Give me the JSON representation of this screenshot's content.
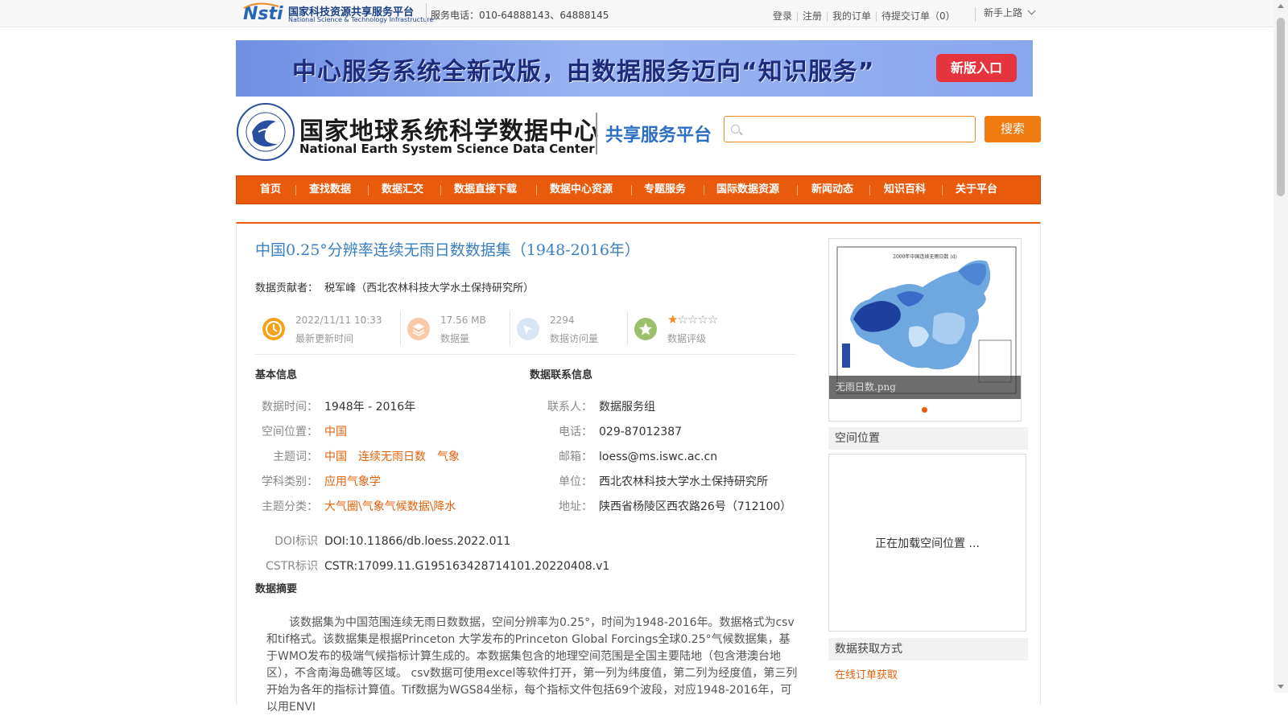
{
  "topbar": {
    "nsti_cn": "国家科技资源共享服务平台",
    "nsti_en": "National Science & Technology Infrastructure",
    "hotline": "服务电话：010-64888143、64888145",
    "links": [
      "登录",
      "注册",
      "我的订单",
      "待提交订单（0）"
    ],
    "newbie": "新手上路"
  },
  "banner": {
    "text": "中心服务系统全新改版，由数据服务迈向“知识服务”",
    "button": "新版入口"
  },
  "header": {
    "title_cn": "国家地球系统科学数据中心",
    "title_en": "National Earth System Science Data Center",
    "platform": "共享服务平台",
    "search_placeholder": "",
    "search_button": "搜索"
  },
  "nav": [
    "首页",
    "查找数据",
    "数据汇交",
    "数据直接下载",
    "数据中心资源",
    "专题服务",
    "国际数据资源",
    "新闻动态",
    "知识百科",
    "关于平台"
  ],
  "dataset": {
    "title": "中国0.25°分辨率连续无雨日数数据集（1948-2016年）",
    "contributor_label": "数据贡献者：",
    "contributor": "税军峰（西北农林科技大学水土保持研究所）",
    "stats": {
      "updated_value": "2022/11/11 10:33",
      "updated_label": "最新更新时间",
      "size_value": "17.56 MB",
      "size_label": "数据量",
      "visits_value": "2294",
      "visits_label": "数据访问量",
      "rating_label": "数据评级",
      "rating": 1,
      "rating_max": 5
    },
    "basic_info": {
      "heading": "基本信息",
      "time_label": "数据时间：",
      "time": "1948年 - 2016年",
      "location_label": "空间位置：",
      "location": "中国",
      "keywords_label": "主题词：",
      "keywords": [
        "中国",
        "连续无雨日数",
        "气象"
      ],
      "discipline_label": "学科类别：",
      "discipline": "应用气象学",
      "category_label": "主题分类：",
      "category": "大气圈\\气象气候数据\\降水",
      "doi_label": "DOI标识",
      "doi": "DOI:10.11866/db.loess.2022.011",
      "cstr_label": "CSTR标识",
      "cstr": "CSTR:17099.11.G195163428714101.20220408.v1"
    },
    "contact": {
      "heading": "数据联系信息",
      "person_label": "联系人：",
      "person": "数据服务组",
      "phone_label": "电话：",
      "phone": "029-87012387",
      "email_label": "邮箱：",
      "email": "loess@ms.iswc.ac.cn",
      "org_label": "单位：",
      "org": "西北农林科技大学水土保持研究所",
      "address_label": "地址：",
      "address": "陕西省杨陵区西农路26号（712100）"
    },
    "abstract_heading": "数据摘要",
    "abstract": "该数据集为中国范围连续无雨日数数据，空间分辨率为0.25°，时间为1948-2016年。数据格式为csv和tif格式。该数据集是根据Princeton 大学发布的Princeton Global Forcings全球0.25°气候数据集，基于WMO发布的极端气候指标计算生成的。本数据集包含的地理空间范围是全国主要陆地（包含港澳台地区），不含南海岛礁等区域。 csv数据可使用excel等软件打开，第一列为纬度值，第二列为经度值，第三列开始为各年的指标计算值。Tif数据为WGS84坐标，每个指标文件包括69个波段，对应1948-2016年，可以用ENVI"
  },
  "sidebar": {
    "thumbnail_caption": "无雨日数.png",
    "spatial_heading": "空间位置",
    "spatial_loading": "正在加载空间位置 ...",
    "access_heading": "数据获取方式",
    "access_link": "在线订单获取"
  },
  "colors": {
    "nav_bg": "#ea5a0c",
    "title_blue": "#3a7fc1",
    "link_orange": "#e2620c",
    "search_btn": "#f07b10",
    "banner_btn": "#e6343f"
  }
}
